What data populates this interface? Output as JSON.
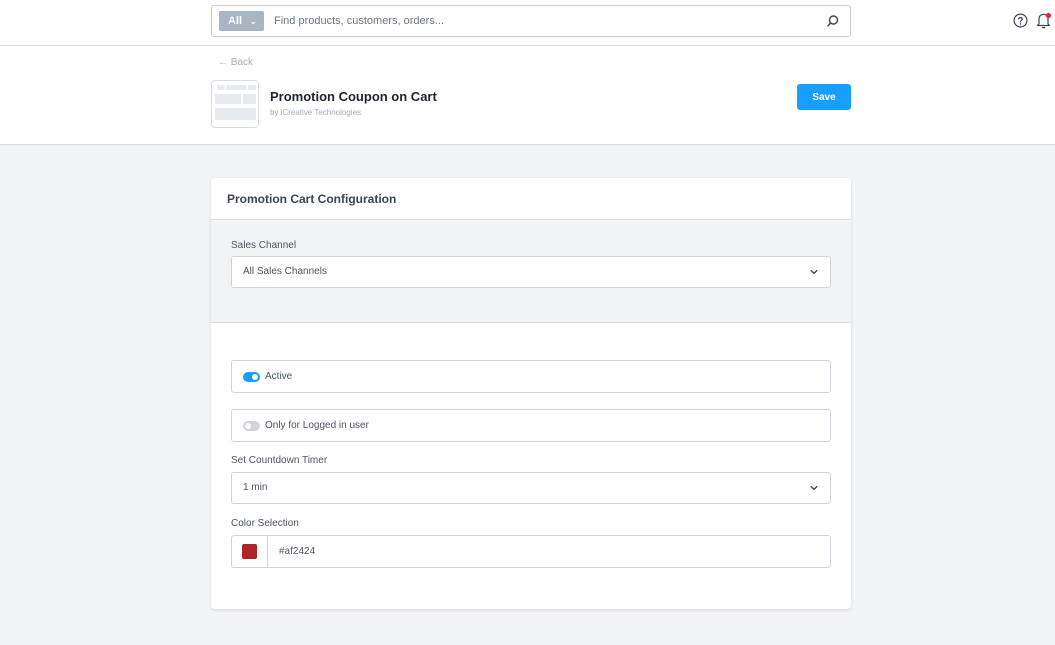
{
  "search": {
    "scope_label": "All",
    "placeholder": "Find products, customers, orders..."
  },
  "header": {
    "back_label": "← Back",
    "title": "Promotion Coupon on Cart",
    "byline": "by iCreative Technologies",
    "save_label": "Save"
  },
  "card": {
    "title": "Promotion Cart Configuration",
    "sales_channel": {
      "label": "Sales Channel",
      "value": "All Sales Channels"
    },
    "active": {
      "label": "Active",
      "checked": true
    },
    "logged_in_only": {
      "label": "Only for Logged in user",
      "checked": false
    },
    "countdown": {
      "label": "Set Countdown Timer",
      "value": "1 min"
    },
    "color": {
      "label": "Color Selection",
      "value": "#af2424"
    }
  },
  "colors": {
    "accent": "#189eff",
    "notification_dot": "#e8273f",
    "toggle_off": "#d1d5db",
    "swatch": "#af2424"
  },
  "icons": {
    "search": "magnifier-icon",
    "help": "help-circle-icon",
    "notifications": "bell-icon"
  }
}
